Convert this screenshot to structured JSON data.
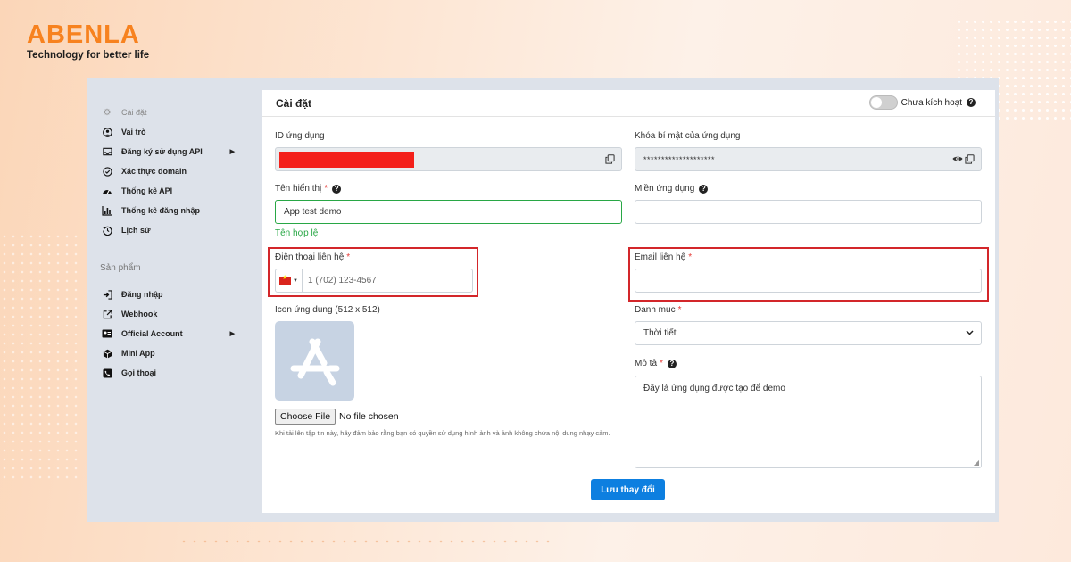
{
  "brand": {
    "name": "ABENLA",
    "tagline": "Technology for better life"
  },
  "sidebar": {
    "items": [
      {
        "label": "Cài đặt",
        "icon": "gear-icon"
      },
      {
        "label": "Vai trò",
        "icon": "user-circle-icon"
      },
      {
        "label": "Đăng ký sử dụng API",
        "icon": "inbox-icon"
      },
      {
        "label": "Xác thực domain",
        "icon": "check-circle-icon"
      },
      {
        "label": "Thống kê API",
        "icon": "gauge-icon"
      },
      {
        "label": "Thống kê đăng nhập",
        "icon": "bar-chart-icon"
      },
      {
        "label": "Lịch sử",
        "icon": "history-icon"
      }
    ],
    "section_label": "Sản phẩm",
    "products": [
      {
        "label": "Đăng nhập",
        "icon": "sign-in-icon"
      },
      {
        "label": "Webhook",
        "icon": "external-link-icon"
      },
      {
        "label": "Official Account",
        "icon": "id-card-icon"
      },
      {
        "label": "Mini App",
        "icon": "cube-icon"
      },
      {
        "label": "Gọi thoại",
        "icon": "phone-icon"
      }
    ]
  },
  "header": {
    "title": "Cài đặt",
    "toggle_label": "Chưa kích hoạt",
    "help": "?"
  },
  "form": {
    "app_id": {
      "label": "ID ứng dụng",
      "value": ""
    },
    "secret": {
      "label": "Khóa bí mật của ứng dụng",
      "value": "********************"
    },
    "display_name": {
      "label": "Tên hiển thị",
      "required": "*",
      "value": "App test demo",
      "valid_text": "Tên hợp lệ"
    },
    "domain": {
      "label": "Miền ứng dụng",
      "value": ""
    },
    "phone": {
      "label": "Điện thoại liên hệ",
      "required": "*",
      "placeholder": "1 (702) 123-4567"
    },
    "email": {
      "label": "Email liên hệ",
      "required": "*",
      "value": ""
    },
    "icon": {
      "label": "Icon ứng dụng (512 x 512)",
      "button": "Choose File",
      "status": "No file chosen",
      "hint": "Khi tải lên tập tin này, hãy đảm bảo rằng bạn có quyền sử dụng hình ảnh và ảnh không chứa nội dung nhạy cảm."
    },
    "category": {
      "label": "Danh mục",
      "required": "*",
      "value": "Thời tiết"
    },
    "description": {
      "label": "Mô tả",
      "required": "*",
      "value": "Đây là ứng dụng được tạo để demo"
    },
    "save_label": "Lưu thay đổi"
  },
  "colors": {
    "brand": "#f7821f",
    "primary": "#0d7fe0",
    "valid": "#28a745",
    "highlight": "#d3262a",
    "required": "#e53935"
  }
}
